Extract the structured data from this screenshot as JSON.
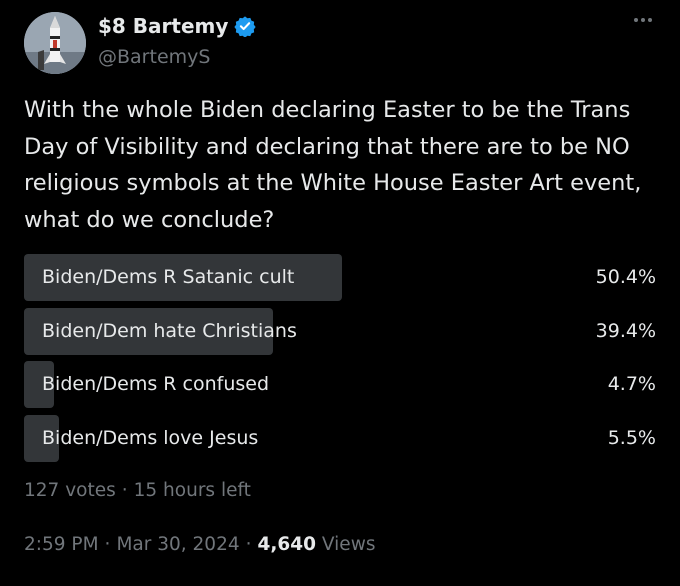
{
  "author": {
    "display_name": "$8 Bartemy",
    "handle": "@BartemyS",
    "verified_color": "#1d9bf0",
    "avatar": "rocket-avatar"
  },
  "tweet": {
    "text": "With the whole Biden declaring Easter to be the Trans Day of Visibility and declaring that there are to be NO religious symbols at the White House Easter Art event, what do we conclude?"
  },
  "poll": {
    "options": [
      {
        "label": "Biden/Dems R Satanic cult",
        "percent": "50.4%",
        "value": 50.4
      },
      {
        "label": "Biden/Dem hate Christians",
        "percent": "39.4%",
        "value": 39.4
      },
      {
        "label": "Biden/Dems R confused",
        "percent": "4.7%",
        "value": 4.7
      },
      {
        "label": "Biden/Dems love Jesus",
        "percent": "5.5%",
        "value": 5.5
      }
    ],
    "votes": "127 votes",
    "time_left": "15 hours left"
  },
  "meta": {
    "time": "2:59 PM",
    "date": "Mar 30, 2024",
    "views_count": "4,640",
    "views_label": "Views"
  },
  "colors": {
    "background": "#000000",
    "bar": "#333639",
    "text": "#e7e9ea",
    "muted": "#71767b"
  }
}
